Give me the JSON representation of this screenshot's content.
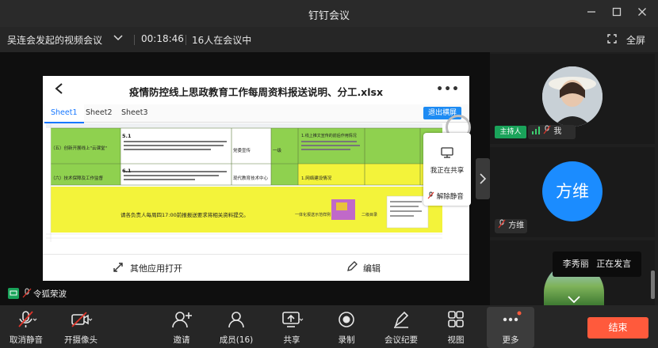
{
  "window": {
    "title": "钉钉会议"
  },
  "info": {
    "meeting_name": "吴连会发起的视频会议",
    "timer": "00:18:46",
    "participants_text": "16人在会议中",
    "fullscreen_label": "全屏"
  },
  "doc": {
    "title": "疫情防控线上思政教育工作每周资料报送说明、分工.xlsx",
    "tabs": [
      "Sheet1",
      "Sheet2",
      "Sheet3"
    ],
    "exit_label": "退出横屏",
    "open_other_label": "其他应用打开",
    "edit_label": "编辑",
    "rows": [
      {
        "col1": "（五）创新开展线上\"云课堂\"",
        "col2_num": "5.1",
        "col3": "党委宣传",
        "col4": "一级",
        "col5": "1.线上推文宣传的前后作用情况"
      },
      {
        "col1": "（六）技术保障及工作监督",
        "col2_num": "6.1",
        "col3": "现代教育技术中心",
        "col4": "",
        "col5": "1.网络建设情况"
      }
    ],
    "notice": "请各负责人每周四17:00前报报送要求将相关资料提交。",
    "notice_right1": "一体化报送示范样例",
    "notice_right2": "二级目录"
  },
  "share_panel": {
    "sharing_label": "我正在共享",
    "unmute_label": "解除静音"
  },
  "participants": {
    "host_badge": "主持人",
    "me_label": "我",
    "second_name": "方维",
    "second_avatar_text": "方维",
    "speaking_name": "李秀丽",
    "speaking_status": "正在发言",
    "stage_name": "令狐荣波"
  },
  "toolbar": {
    "items": [
      {
        "label": "取消静音"
      },
      {
        "label": "开摄像头"
      },
      {
        "label": "邀请"
      },
      {
        "label": "成员(16)"
      },
      {
        "label": "共享"
      },
      {
        "label": "录制"
      },
      {
        "label": "会议纪要"
      },
      {
        "label": "视图"
      },
      {
        "label": "更多"
      }
    ],
    "end_label": "结束"
  },
  "colors": {
    "accent": "#1677ff",
    "sheet_green": "#8fd14f",
    "sheet_yellow": "#f3f33a",
    "end": "#ff5a3c",
    "host": "#1aa35a"
  }
}
